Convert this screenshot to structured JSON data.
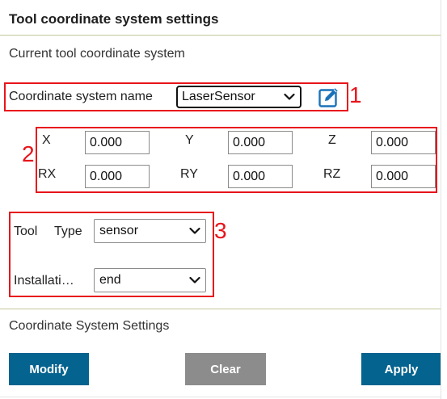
{
  "header": {
    "title": "Tool coordinate system settings",
    "subtitle": "Current tool coordinate system"
  },
  "coordinate_system": {
    "label": "Coordinate system name",
    "selected": "LaserSensor",
    "edit_icon": "pencil-square-icon"
  },
  "coordinates": {
    "x": {
      "label": "X",
      "value": "0.000"
    },
    "y": {
      "label": "Y",
      "value": "0.000"
    },
    "z": {
      "label": "Z",
      "value": "0.000"
    },
    "rx": {
      "label": "RX",
      "value": "0.000"
    },
    "ry": {
      "label": "RY",
      "value": "0.000"
    },
    "rz": {
      "label": "RZ",
      "value": "0.000"
    }
  },
  "tool": {
    "tool_label": "Tool",
    "type_label": "Type",
    "type_value": "sensor",
    "installation_label": "Installati…",
    "installation_value": "end"
  },
  "annotations": {
    "box1": "1",
    "box2": "2",
    "box3": "3"
  },
  "settings": {
    "label": "Coordinate System Settings"
  },
  "buttons": {
    "modify": "Modify",
    "clear": "Clear",
    "apply": "Apply"
  },
  "colors": {
    "primary": "#04638f",
    "neutral": "#8c8c8c",
    "annotation": "#e8141b",
    "rule": "#c5c89a",
    "icon": "#1a73b8"
  }
}
